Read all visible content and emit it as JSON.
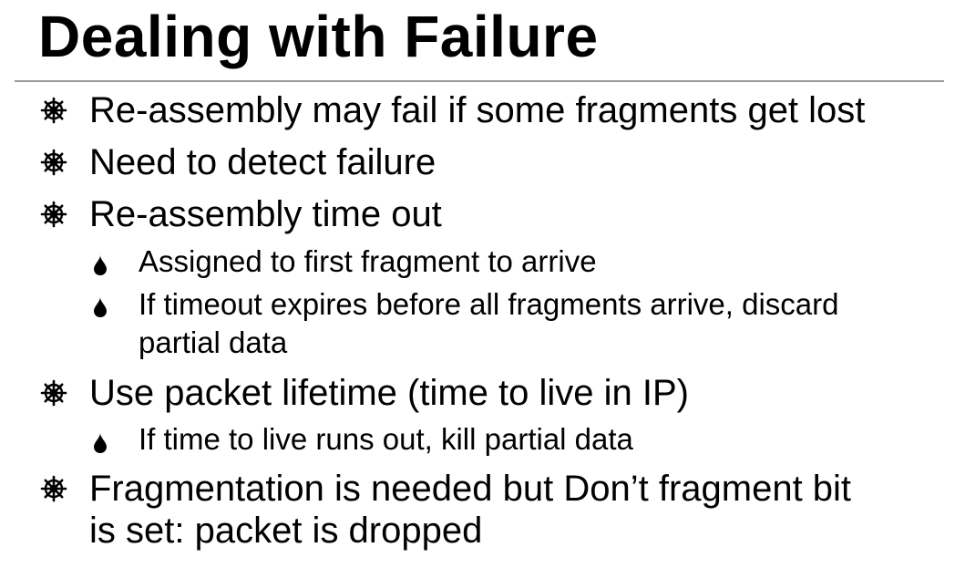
{
  "slide": {
    "title": "Dealing with Failure",
    "bullets": [
      {
        "level": 1,
        "icon": "wheel-bullet-icon",
        "lines": [
          "Re-assembly may fail if some fragments get lost"
        ]
      },
      {
        "level": 1,
        "icon": "wheel-bullet-icon",
        "lines": [
          "Need to detect failure"
        ]
      },
      {
        "level": 1,
        "icon": "wheel-bullet-icon",
        "lines": [
          "Re-assembly time out"
        ]
      },
      {
        "level": 2,
        "icon": "drop-bullet-icon",
        "lines": [
          "Assigned to first fragment to arrive"
        ]
      },
      {
        "level": 2,
        "icon": "drop-bullet-icon",
        "lines": [
          "If timeout expires before all fragments arrive, discard",
          "partial data"
        ]
      },
      {
        "level": 1,
        "icon": "wheel-bullet-icon",
        "lines": [
          "Use packet lifetime (time to live in IP)"
        ]
      },
      {
        "level": 2,
        "icon": "drop-bullet-icon",
        "lines": [
          "If time to live runs out, kill partial data"
        ]
      },
      {
        "level": 1,
        "icon": "wheel-bullet-icon",
        "lines": [
          "Fragmentation is needed but Don’t fragment bit",
          "is set:  packet is dropped"
        ]
      }
    ]
  },
  "colors": {
    "text": "#000000",
    "rule": "#9a9a9a",
    "background": "#ffffff"
  }
}
